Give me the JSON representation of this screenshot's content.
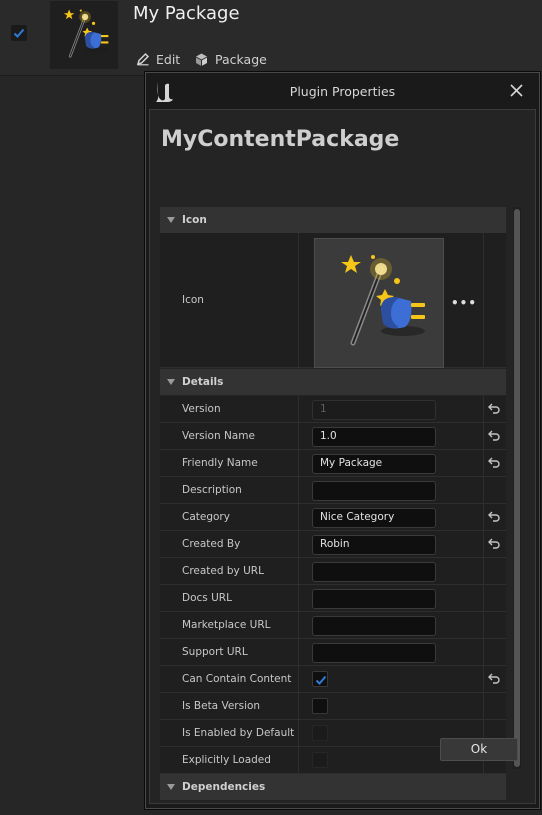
{
  "entry": {
    "title": "My Package",
    "enabled": true,
    "edit_label": "Edit",
    "package_label": "Package"
  },
  "dialog": {
    "title": "Plugin Properties",
    "plugin_name": "MyContentPackage",
    "ok_label": "Ok",
    "categories": {
      "icon": "Icon",
      "details": "Details",
      "dependencies": "Dependencies"
    },
    "icon_row": {
      "label": "Icon",
      "more": "•••"
    },
    "details": {
      "version": {
        "label": "Version",
        "value": "1"
      },
      "version_name": {
        "label": "Version Name",
        "value": "1.0"
      },
      "friendly_name": {
        "label": "Friendly Name",
        "value": "My Package"
      },
      "description": {
        "label": "Description",
        "value": ""
      },
      "category": {
        "label": "Category",
        "value": "Nice Category"
      },
      "created_by": {
        "label": "Created By",
        "value": "Robin"
      },
      "created_by_url": {
        "label": "Created by URL",
        "value": ""
      },
      "docs_url": {
        "label": "Docs URL",
        "value": ""
      },
      "marketplace_url": {
        "label": "Marketplace URL",
        "value": ""
      },
      "support_url": {
        "label": "Support URL",
        "value": ""
      },
      "can_contain_content": {
        "label": "Can Contain Content",
        "checked": true
      },
      "is_beta_version": {
        "label": "Is Beta Version",
        "checked": false
      },
      "is_enabled_by_default": {
        "label": "Is Enabled by Default",
        "checked": false
      },
      "explicitly_loaded": {
        "label": "Explicitly Loaded",
        "checked": false
      }
    }
  },
  "icons": {
    "check": "checkmark-icon",
    "edit": "pencil-icon",
    "package": "package-icon",
    "engine": "unreal-logo-icon",
    "close": "close-icon",
    "reset": "reset-to-default-icon",
    "plugin": "magic-wand-plug-icon"
  },
  "colors": {
    "accent_blue": "#2f7bd8",
    "star_yellow": "#f5c518",
    "plug_blue": "#3d6ed6"
  }
}
